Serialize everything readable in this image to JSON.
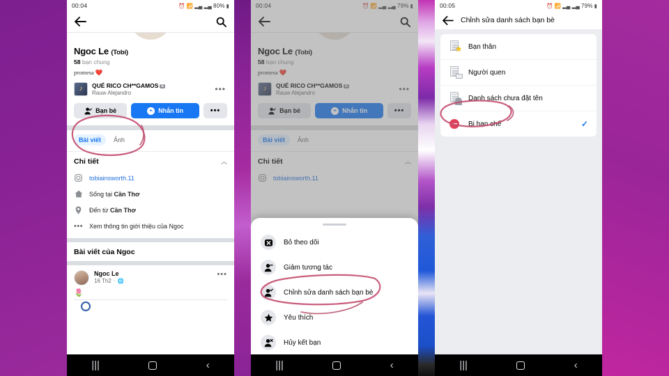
{
  "panels": [
    {
      "id": "panel-profile",
      "status": {
        "time": "00:04",
        "battery": "80%",
        "icons": [
          "alarm-icon",
          "wifi-icon",
          "signal-icon",
          "signal-icon"
        ]
      },
      "topbar": {
        "back": "back-arrow-icon",
        "search": "search-icon"
      },
      "profile": {
        "name": "Ngoc Le",
        "alias": "(Tobi)",
        "mutual_count": "58",
        "mutual_label": "bạn chung",
        "bio": "promesa ❤️"
      },
      "music": {
        "title": "QUÉ RICO CH**GAMOS",
        "badge": "E",
        "artist": "Rauw Alejandro",
        "more": "•••"
      },
      "actions": {
        "friend_label": "Bạn bè",
        "message_label": "Nhắn tin",
        "more_label": "•••"
      },
      "tabs": [
        {
          "label": "Bài viết",
          "active": true
        },
        {
          "label": "Ảnh",
          "active": false
        }
      ],
      "details": {
        "title": "Chi tiết",
        "collapse_icon": "chevron-up-icon",
        "rows": [
          {
            "icon": "instagram-icon",
            "text": "tobiainsworth.11",
            "link": true
          },
          {
            "icon": "home-icon",
            "text_plain": "Sống tại ",
            "text_bold": "Cần Thơ"
          },
          {
            "icon": "location-pin-icon",
            "text_plain": "Đến từ ",
            "text_bold": "Cần Thơ"
          },
          {
            "icon": "ellipsis-icon",
            "text": "Xem thông tin giới thiệu của Ngoc"
          }
        ]
      },
      "posts_header": "Bài viết của Ngoc",
      "post": {
        "author": "Ngoc Le",
        "time": "16 Th2",
        "privacy_icon": "globe-icon",
        "more": "•••",
        "body": "🌷"
      },
      "navbar": {
        "recents": "|||",
        "home": "home-square-icon",
        "back": "‹"
      },
      "annotation": "red-circle-around-friend-button"
    },
    {
      "id": "panel-menu",
      "status": {
        "time": "00:04",
        "battery": "79%"
      },
      "sheet_items": [
        {
          "icon": "unfollow-icon",
          "label": "Bỏ theo dõi"
        },
        {
          "icon": "person-minus-icon",
          "label": "Giảm tương tác"
        },
        {
          "icon": "person-edit-icon",
          "label": "Chỉnh sửa danh sách bạn bè"
        },
        {
          "icon": "star-icon",
          "label": "Yêu thích"
        },
        {
          "icon": "person-remove-icon",
          "label": "Hủy kết bạn"
        }
      ],
      "annotation": "red-circle-around-edit-friend-list"
    },
    {
      "id": "panel-friend-lists",
      "status": {
        "time": "00:05",
        "battery": "79%"
      },
      "title": "Chỉnh sửa danh sách bạn bè",
      "back": "back-arrow-icon",
      "lists": [
        {
          "icon": "list-star-icon",
          "label": "Bạn thân",
          "checked": false
        },
        {
          "icon": "list-card-icon",
          "label": "Người quen",
          "checked": false
        },
        {
          "icon": "list-person-icon",
          "label": "Danh sách chưa đặt tên",
          "checked": false
        },
        {
          "icon": "list-restricted-icon",
          "label": "Bị hạn chế",
          "checked": true,
          "check_mark": "✓"
        }
      ],
      "annotation": "red-circle-around-restricted"
    }
  ],
  "colors": {
    "facebook_blue": "#1877f2",
    "background_purple": "#8c2396",
    "marker_red": "#c2476a",
    "grey_button": "#e4e6eb"
  }
}
